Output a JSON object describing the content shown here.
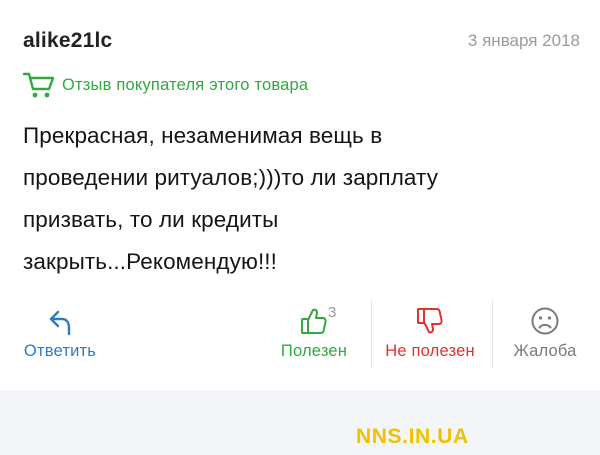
{
  "review": {
    "author": "alike21lc",
    "date": "3 января 2018",
    "badge_icon": "shopping-cart-icon",
    "badge_text": "Отзыв покупателя этого товара",
    "text_lines": [
      "Прекрасная, незаменимая вещь в",
      "проведении ритуалов;)))то ли зарплату",
      "призвать, то ли кредиты",
      "закрыть...Рекомендую!!!"
    ]
  },
  "actions": {
    "reply": {
      "label": "Ответить",
      "icon": "reply-arrow-icon"
    },
    "useful": {
      "label": "Полезен",
      "count": "3",
      "icon": "thumbs-up-icon"
    },
    "not_useful": {
      "label": "Не полезен",
      "icon": "thumbs-down-icon"
    },
    "complaint": {
      "label": "Жалоба",
      "icon": "sad-face-icon"
    }
  },
  "watermark": "NNS.IN.UA",
  "colors": {
    "green": "#2faa3e",
    "blue": "#2e7bc4",
    "red": "#e0322c",
    "gray": "#9a9a9a",
    "watermark": "#f0c100"
  }
}
